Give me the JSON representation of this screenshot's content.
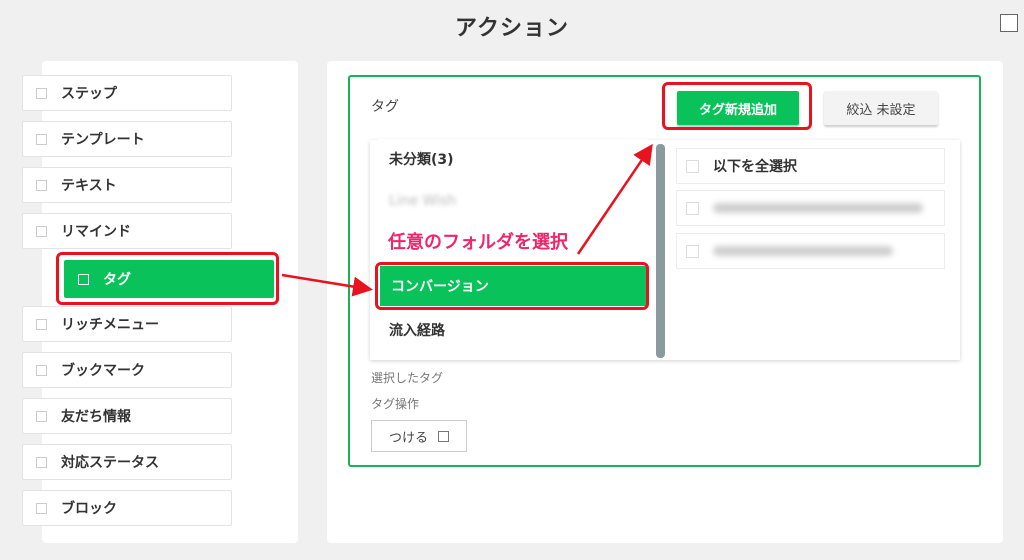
{
  "title": "アクション",
  "menu": [
    {
      "label": "ステップ",
      "active": false
    },
    {
      "label": "テンプレート",
      "active": false
    },
    {
      "label": "テキスト",
      "active": false
    },
    {
      "label": "リマインド",
      "active": false
    },
    {
      "label": "タグ",
      "active": true
    },
    {
      "label": "リッチメニュー",
      "active": false
    },
    {
      "label": "ブックマーク",
      "active": false
    },
    {
      "label": "友だち情報",
      "active": false
    },
    {
      "label": "対応ステータス",
      "active": false
    },
    {
      "label": "ブロック",
      "active": false
    }
  ],
  "tag_section": {
    "label": "タグ",
    "new_tag_button": "タグ新規追加",
    "filter_button": "絞込 未設定"
  },
  "folders": [
    {
      "label": "未分類(3)",
      "active": false,
      "blurred": false
    },
    {
      "label": "Line Wish",
      "active": false,
      "blurred": true
    },
    {
      "label": "コンバージョン",
      "active": true,
      "blurred": false
    },
    {
      "label": "流入経路",
      "active": false,
      "blurred": false
    }
  ],
  "tag_list": {
    "select_all": "以下を全選択"
  },
  "annotation": "任意のフォルダを選択",
  "selected_tag_label": "選択したタグ",
  "tag_operation_label": "タグ操作",
  "attach_button": "つける",
  "colors": {
    "accent_green": "#0ac25a",
    "highlight_red": "#e8131f",
    "annotation_pink": "#f0256b"
  }
}
